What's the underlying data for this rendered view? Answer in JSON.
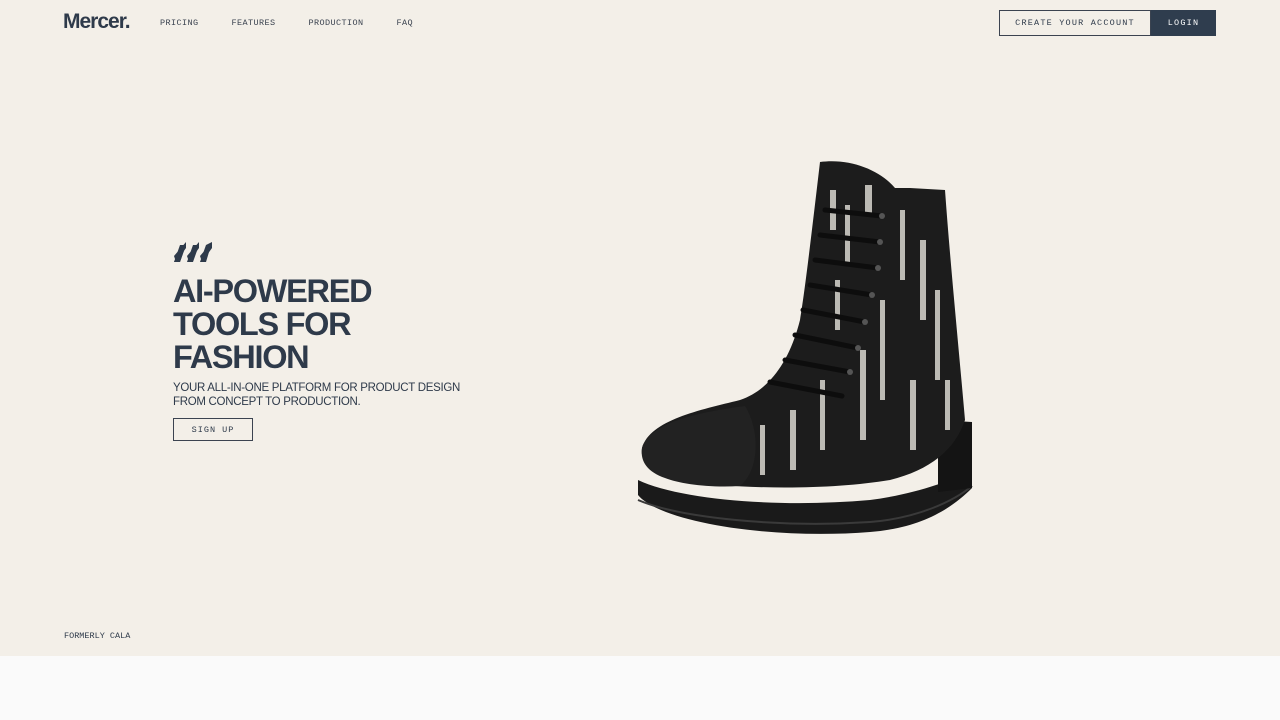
{
  "brand": {
    "logo": "Mercer."
  },
  "nav": {
    "links": [
      {
        "label": "PRICING"
      },
      {
        "label": "FEATURES"
      },
      {
        "label": "PRODUCTION"
      },
      {
        "label": "FAQ"
      }
    ],
    "create_account_label": "CREATE YOUR ACCOUNT",
    "login_label": "LOGIN"
  },
  "hero": {
    "headline_lines": [
      "AI-POWERED",
      "TOOLS FOR",
      "FASHION"
    ],
    "subhead_lines": [
      "YOUR ALL-IN-ONE PLATFORM FOR PRODUCT DESIGN",
      "FROM CONCEPT TO PRODUCTION."
    ],
    "signup_label": "SIGN UP",
    "image_subject": "combat-boot"
  },
  "footer_note": "FORMERLY CALA",
  "colors": {
    "hero_bg": "#f3efe8",
    "primary_navy": "#2f3d4e",
    "text": "#2e3a4a",
    "footer_bg": "#fafafa"
  }
}
